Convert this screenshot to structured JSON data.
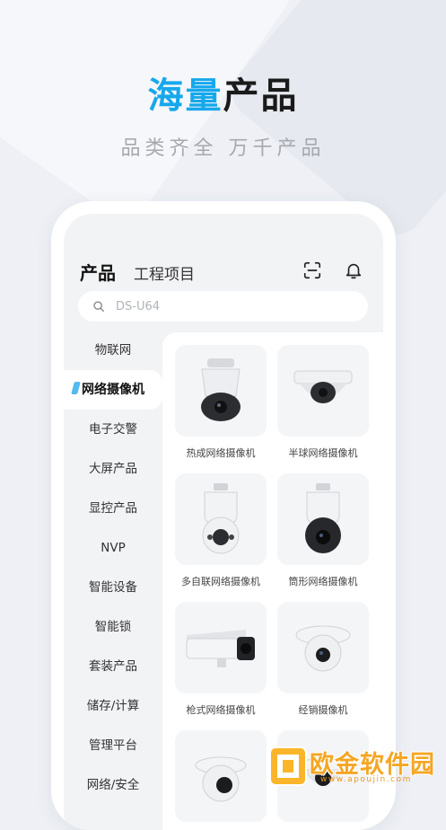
{
  "headline": {
    "blue": "海量",
    "dark": "产品"
  },
  "subtitle": "品类齐全  万千产品",
  "app": {
    "tabs": [
      {
        "label": "产品",
        "active": true
      },
      {
        "label": "工程项目",
        "active": false
      }
    ],
    "icons": [
      "scan-icon",
      "bell-icon"
    ],
    "search": {
      "placeholder": "DS-U64",
      "value": ""
    },
    "sidebar": [
      {
        "label": "物联网"
      },
      {
        "label": "网络摄像机",
        "active": true
      },
      {
        "label": "电子交警"
      },
      {
        "label": "大屏产品"
      },
      {
        "label": "显控产品"
      },
      {
        "label": "NVP"
      },
      {
        "label": "智能设备"
      },
      {
        "label": "智能锁"
      },
      {
        "label": "套装产品"
      },
      {
        "label": "储存/计算"
      },
      {
        "label": "管理平台"
      },
      {
        "label": "网络/安全"
      }
    ],
    "products": [
      {
        "label": "热成网络摄像机",
        "icon": "ptz-dome-camera-icon"
      },
      {
        "label": "半球网络摄像机",
        "icon": "dome-camera-icon"
      },
      {
        "label": "多自联网络摄像机",
        "icon": "speed-dome-white-icon"
      },
      {
        "label": "筒形网络摄像机",
        "icon": "speed-dome-dark-icon"
      },
      {
        "label": "枪式网络摄像机",
        "icon": "bullet-camera-icon"
      },
      {
        "label": "经销摄像机",
        "icon": "turret-camera-icon"
      },
      {
        "label": "",
        "icon": "turret-camera-icon"
      },
      {
        "label": "",
        "icon": "dome-camera-icon"
      }
    ],
    "colors": {
      "accent": "#17a8ec",
      "background": "#eef0f5"
    }
  },
  "watermark": {
    "brand": "欧金软件园",
    "url": "www.apoujin.com"
  }
}
